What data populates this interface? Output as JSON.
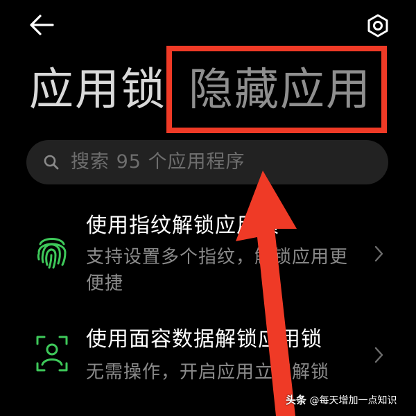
{
  "header": {
    "back_icon": "arrow-left-icon",
    "settings_icon": "settings-hexagon-icon"
  },
  "tabs": [
    {
      "label": "应用锁",
      "active": true
    },
    {
      "label": "隐藏应用",
      "active": false
    }
  ],
  "search": {
    "icon": "search-icon",
    "placeholder": "搜索 95 个应用程序"
  },
  "list": [
    {
      "icon": "fingerprint-icon",
      "title": "使用指纹解锁应用锁",
      "description": "支持设置多个指纹，解锁应用更便捷"
    },
    {
      "icon": "face-scan-icon",
      "title": "使用面容数据解锁应用锁",
      "description": "无需操作，开启应用立即解锁"
    }
  ],
  "partial_item_title": "...",
  "annotations": {
    "highlight_color": "#ef3a26",
    "arrow_color": "#ef3a26"
  },
  "watermark": {
    "brand": "头条",
    "handle": "@每天增加一点知识"
  },
  "colors": {
    "background": "#000000",
    "accent_green": "#3ec95a",
    "title_active": "#d9d9d9",
    "title_inactive": "#8f8f8f",
    "desc_gray": "#8a8a8a"
  }
}
